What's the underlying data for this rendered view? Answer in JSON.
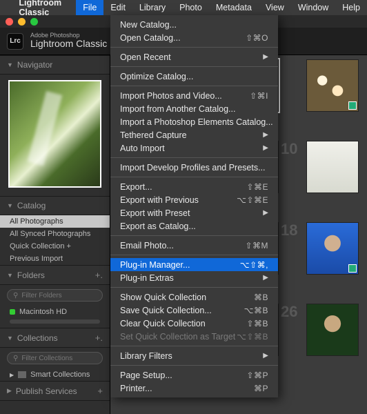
{
  "menubar": {
    "app_name": "Lightroom Classic",
    "items": [
      "File",
      "Edit",
      "Library",
      "Photo",
      "Metadata",
      "View",
      "Window",
      "Help"
    ],
    "active_index": 0
  },
  "app_header": {
    "logo_text": "Lrc",
    "line1": "Adobe Photoshop",
    "line2": "Lightroom Classic"
  },
  "file_menu": {
    "groups": [
      [
        {
          "label": "New Catalog..."
        },
        {
          "label": "Open Catalog...",
          "shortcut": "⇧⌘O"
        }
      ],
      [
        {
          "label": "Open Recent",
          "submenu": true
        }
      ],
      [
        {
          "label": "Optimize Catalog..."
        }
      ],
      [
        {
          "label": "Import Photos and Video...",
          "shortcut": "⇧⌘I"
        },
        {
          "label": "Import from Another Catalog..."
        },
        {
          "label": "Import a Photoshop Elements Catalog..."
        },
        {
          "label": "Tethered Capture",
          "submenu": true
        },
        {
          "label": "Auto Import",
          "submenu": true
        }
      ],
      [
        {
          "label": "Import Develop Profiles and Presets..."
        }
      ],
      [
        {
          "label": "Export...",
          "shortcut": "⇧⌘E"
        },
        {
          "label": "Export with Previous",
          "shortcut": "⌥⇧⌘E"
        },
        {
          "label": "Export with Preset",
          "submenu": true
        },
        {
          "label": "Export as Catalog..."
        }
      ],
      [
        {
          "label": "Email Photo...",
          "shortcut": "⇧⌘M"
        }
      ],
      [
        {
          "label": "Plug-in Manager...",
          "shortcut": "⌥⇧⌘,",
          "highlight": true
        },
        {
          "label": "Plug-in Extras",
          "submenu": true
        }
      ],
      [
        {
          "label": "Show Quick Collection",
          "shortcut": "⌘B"
        },
        {
          "label": "Save Quick Collection...",
          "shortcut": "⌥⌘B"
        },
        {
          "label": "Clear Quick Collection",
          "shortcut": "⇧⌘B"
        },
        {
          "label": "Set Quick Collection as Target",
          "shortcut": "⌥⇧⌘B",
          "disabled": true
        }
      ],
      [
        {
          "label": "Library Filters",
          "submenu": true
        }
      ],
      [
        {
          "label": "Page Setup...",
          "shortcut": "⇧⌘P"
        },
        {
          "label": "Printer...",
          "shortcut": "⌘P"
        }
      ]
    ]
  },
  "panels": {
    "navigator": "Navigator",
    "catalog": "Catalog",
    "catalog_items": [
      "All Photographs",
      "All Synced Photographs",
      "Quick Collection  +",
      "Previous Import"
    ],
    "catalog_selected_index": 0,
    "folders": "Folders",
    "folders_filter_placeholder": "Filter Folders",
    "drive": "Macintosh HD",
    "collections": "Collections",
    "collections_filter_placeholder": "Filter Collections",
    "smart_collections": "Smart Collections",
    "publish": "Publish Services"
  },
  "grid": {
    "row_labels": [
      "",
      "10",
      "18",
      "26"
    ]
  }
}
